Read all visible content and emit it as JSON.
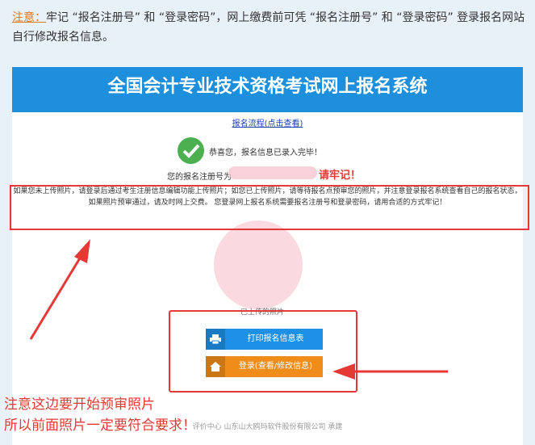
{
  "note": {
    "label": "注意：",
    "text": "牢记 “报名注册号” 和 “登录密码”，网上缴费前可凭 “报名注册号” 和 “登录密码” 登录报名网站自行修改报名信息。"
  },
  "banner": {
    "title": "全国会计专业技术资格考试网上报名系统"
  },
  "flow_link": "报名流程(点击查看)",
  "success_message": "恭喜您，报名信息已录入完毕！",
  "regno_label": "您的报名注册号为",
  "remember": "请牢记！",
  "info_text": "如果您未上传照片，请登录后通过考生注册信息编辑功能上传照片；如您已上传照片，请等待报名点预审您的照片，并注意登录报名系统查看自己的报名状态，如果照片预审通过，请及时网上交费。 您登录网上报名系统需要报名注册号和登录密码，请用合适的方式牢记！",
  "photo_label": "已上传的照片",
  "buttons": {
    "print_label": "打印报名信息表",
    "login_label": "登录(查看/修改信息)"
  },
  "footer": "评价中心    山东山大鸥玛软件股份有限公司 承建",
  "annotation": {
    "line1": "注意这边要开始预审照片",
    "line2": "所以前面照片一定要符合要求！"
  },
  "colors": {
    "banner": "#1d8fdc",
    "highlight": "#e53935",
    "print_button": "#1e90e6",
    "login_button": "#f08c1a"
  }
}
